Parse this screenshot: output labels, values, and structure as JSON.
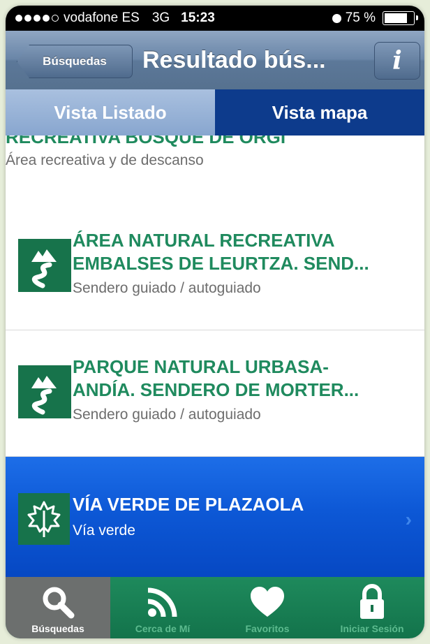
{
  "status_bar": {
    "carrier": "vodafone ES",
    "network": "3G",
    "time": "15:23",
    "battery": "75 %",
    "signal_bars_filled": 4,
    "signal_bars_total": 5,
    "battery_level_percent": 75
  },
  "nav": {
    "back_label": "Búsquedas",
    "title": "Resultado bús...",
    "info_label": "i"
  },
  "tabs": {
    "list_label": "Vista Listado",
    "map_label": "Vista mapa"
  },
  "results": [
    {
      "title": "RECREATIVA BOSQUE DE ORGI",
      "subtitle": "Área recreativa y de descanso",
      "icon": "mountain-trail-icon"
    },
    {
      "title_line1": "ÁREA NATURAL RECREATIVA",
      "title_line2": "EMBALSES DE LEURTZA. SEND...",
      "subtitle": "Sendero guiado / autoguiado",
      "icon": "mountain-trail-icon"
    },
    {
      "title_line1": "PARQUE NATURAL URBASA-",
      "title_line2": "ANDÍA. SENDERO DE MORTER...",
      "subtitle": "Sendero guiado / autoguiado",
      "icon": "mountain-trail-icon"
    },
    {
      "title": "VÍA VERDE DE PLAZAOLA",
      "subtitle": "Vía verde",
      "icon": "leaf-icon",
      "selected": true
    }
  ],
  "tabbar": [
    {
      "label": "Búsquedas",
      "icon": "search-icon",
      "active": true
    },
    {
      "label": "Cerca de Mí",
      "icon": "nearby-signal-icon",
      "active": false
    },
    {
      "label": "Favoritos",
      "icon": "heart-icon",
      "active": false
    },
    {
      "label": "Iniciar Sesión",
      "icon": "lock-icon",
      "active": false
    }
  ],
  "colors": {
    "brand_green": "#17734b",
    "title_green": "#1f8a5e",
    "selected_blue": "#0d58d6",
    "tab_active_blue": "#0d3b8c"
  }
}
